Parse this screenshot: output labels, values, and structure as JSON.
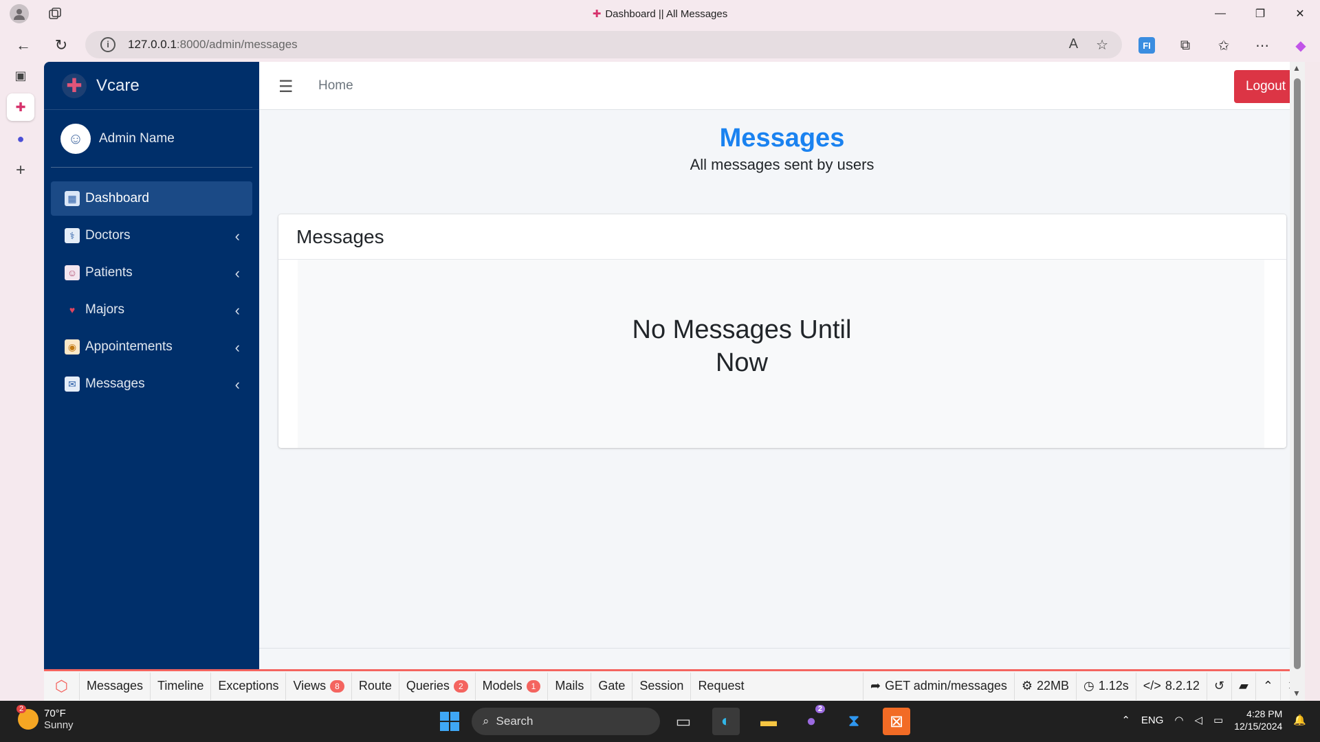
{
  "browser": {
    "tab_title": "Dashboard || All Messages",
    "url_host": "127.0.0.1",
    "url_path": ":8000/admin/messages",
    "window_controls": {
      "minimize": "—",
      "maximize": "❐",
      "close": "✕"
    }
  },
  "sidebar": {
    "brand": "Vcare",
    "user_name": "Admin Name",
    "items": [
      {
        "label": "Dashboard",
        "icon": "dashboard-icon",
        "active": true
      },
      {
        "label": "Doctors",
        "icon": "doctors-icon"
      },
      {
        "label": "Patients",
        "icon": "patients-icon"
      },
      {
        "label": "Majors",
        "icon": "majors-icon"
      },
      {
        "label": "Appointements",
        "icon": "appointments-icon"
      },
      {
        "label": "Messages",
        "icon": "messages-icon"
      }
    ]
  },
  "topnav": {
    "home_label": "Home",
    "logout_label": "Logout"
  },
  "page": {
    "title": "Messages",
    "subtitle": "All messages sent by users"
  },
  "card": {
    "title": "Messages",
    "empty_line1": "No Messages Until",
    "empty_line2": "Now"
  },
  "debugbar": {
    "tabs": [
      {
        "label": "Messages"
      },
      {
        "label": "Timeline"
      },
      {
        "label": "Exceptions"
      },
      {
        "label": "Views",
        "badge": "8"
      },
      {
        "label": "Route"
      },
      {
        "label": "Queries",
        "badge": "2"
      },
      {
        "label": "Models",
        "badge": "1"
      },
      {
        "label": "Mails"
      },
      {
        "label": "Gate"
      },
      {
        "label": "Session"
      },
      {
        "label": "Request"
      }
    ],
    "request": "GET admin/messages",
    "memory": "22MB",
    "time": "1.12s",
    "php_version": "8.2.12"
  },
  "taskbar": {
    "weather_temp": "70°F",
    "weather_desc": "Sunny",
    "weather_badge": "2",
    "search_label": "Search",
    "notification_badge": "2",
    "language": "ENG",
    "time": "4:28 PM",
    "date": "12/15/2024"
  },
  "colors": {
    "sidebar_bg": "#002f6a",
    "title_blue": "#1a82f0",
    "logout_red": "#dc3545",
    "debug_accent": "#f4645f"
  }
}
